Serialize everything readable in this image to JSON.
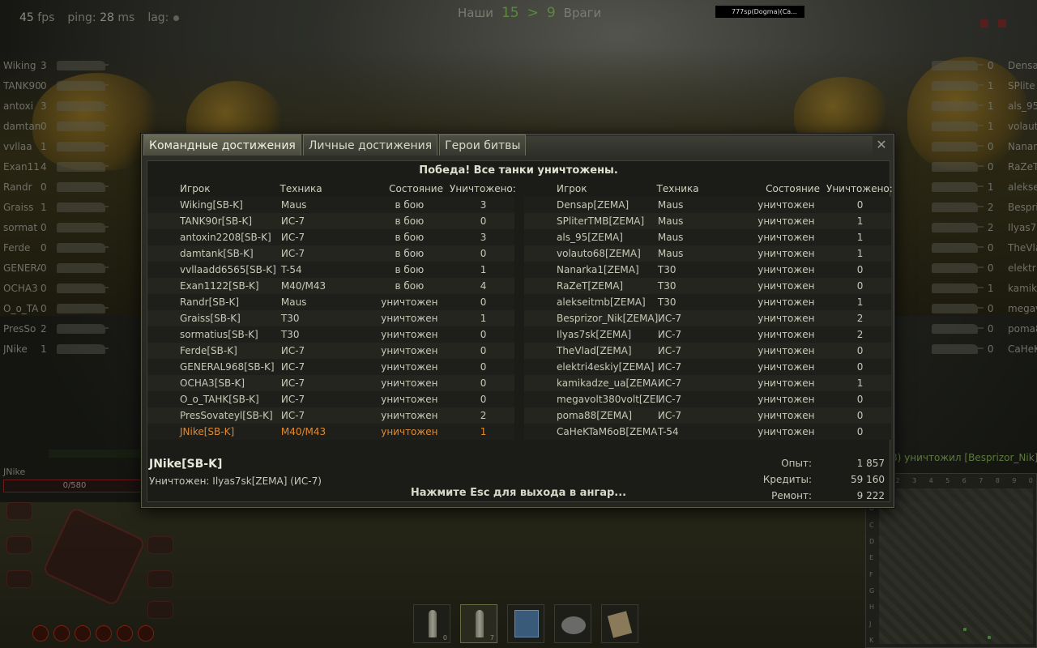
{
  "hud": {
    "fps_value": "45",
    "fps_label": "fps",
    "ping_label": "ping:",
    "ping_value": "28",
    "ping_unit": "ms",
    "lag_label": "lag:",
    "allies_label": "Наши",
    "allies_score": "15",
    "score_sep": ">",
    "enemies_score": "9",
    "enemies_label": "Враги",
    "player_tag": "777sp(Dogma)(Ca..."
  },
  "left_team_side": [
    {
      "name": "Wiking",
      "frags": "3"
    },
    {
      "name": "TANK90",
      "frags": "0"
    },
    {
      "name": "antoxi",
      "frags": "3"
    },
    {
      "name": "damtan",
      "frags": "0"
    },
    {
      "name": "vvllaa",
      "frags": "1"
    },
    {
      "name": "Exan11",
      "frags": "4"
    },
    {
      "name": "Randr",
      "frags": "0"
    },
    {
      "name": "Graiss",
      "frags": "1"
    },
    {
      "name": "sormat",
      "frags": "0"
    },
    {
      "name": "Ferde",
      "frags": "0"
    },
    {
      "name": "GENERA",
      "frags": "0"
    },
    {
      "name": "OCHA3",
      "frags": "0"
    },
    {
      "name": "O_o_TA",
      "frags": "0"
    },
    {
      "name": "PresSo",
      "frags": "2"
    },
    {
      "name": "JNike",
      "frags": "1"
    }
  ],
  "right_team_side": [
    {
      "name": "Densap",
      "frags": "0"
    },
    {
      "name": "SPlite",
      "frags": "1"
    },
    {
      "name": "als_95",
      "frags": "1"
    },
    {
      "name": "volaut",
      "frags": "1"
    },
    {
      "name": "Nanark",
      "frags": "0"
    },
    {
      "name": "RaZeT",
      "frags": "0"
    },
    {
      "name": "alekse",
      "frags": "1"
    },
    {
      "name": "Bespri",
      "frags": "2"
    },
    {
      "name": "Ilyas7",
      "frags": "2"
    },
    {
      "name": "TheVla",
      "frags": "0"
    },
    {
      "name": "elektr",
      "frags": "0"
    },
    {
      "name": "kamika",
      "frags": "1"
    },
    {
      "name": "megavo",
      "frags": "0"
    },
    {
      "name": "poma88",
      "frags": "0"
    },
    {
      "name": "CaHeKT",
      "frags": "0"
    }
  ],
  "self_panel": {
    "name": "JNike",
    "hp": "0/580"
  },
  "kill_message": "8) уничтожил [Besprizor_Nik]",
  "ammo": [
    {
      "type": "shell",
      "count": "0"
    },
    {
      "type": "shell",
      "count": "7"
    },
    {
      "type": "box",
      "count": ""
    },
    {
      "type": "roll",
      "count": ""
    },
    {
      "type": "pack",
      "count": ""
    }
  ],
  "minimap": {
    "cols": [
      "1",
      "2",
      "3",
      "4",
      "5",
      "6",
      "7",
      "8",
      "9",
      "0"
    ],
    "rows": [
      "A",
      "B",
      "C",
      "D",
      "E",
      "F",
      "G",
      "H",
      "J",
      "K"
    ]
  },
  "dialog": {
    "tabs": [
      "Командные достижения",
      "Личные достижения",
      "Герои битвы"
    ],
    "active_tab": 0,
    "close_glyph": "✕",
    "result": "Победа! Все танки уничтожены.",
    "headers": {
      "player": "Игрок",
      "vehicle": "Техника",
      "status": "Состояние",
      "kills": "Уничтожено:"
    },
    "left_team": [
      {
        "player": "Wiking[SB-K]",
        "vehicle": "Maus",
        "status": "в бою",
        "kills": "3"
      },
      {
        "player": "TANK90r[SB-K]",
        "vehicle": "ИС-7",
        "status": "в бою",
        "kills": "0"
      },
      {
        "player": "antoxin2208[SB-K]",
        "vehicle": "ИС-7",
        "status": "в бою",
        "kills": "3"
      },
      {
        "player": "damtank[SB-K]",
        "vehicle": "ИС-7",
        "status": "в бою",
        "kills": "0"
      },
      {
        "player": "vvllaadd6565[SB-K]",
        "vehicle": "T-54",
        "status": "в бою",
        "kills": "1"
      },
      {
        "player": "Exan1122[SB-K]",
        "vehicle": "M40/M43",
        "status": "в бою",
        "kills": "4"
      },
      {
        "player": "Randr[SB-K]",
        "vehicle": "Maus",
        "status": "уничтожен",
        "kills": "0"
      },
      {
        "player": "Graiss[SB-K]",
        "vehicle": "T30",
        "status": "уничтожен",
        "kills": "1"
      },
      {
        "player": "sormatius[SB-K]",
        "vehicle": "T30",
        "status": "уничтожен",
        "kills": "0"
      },
      {
        "player": "Ferde[SB-K]",
        "vehicle": "ИС-7",
        "status": "уничтожен",
        "kills": "0"
      },
      {
        "player": "GENERAL968[SB-K]",
        "vehicle": "ИС-7",
        "status": "уничтожен",
        "kills": "0"
      },
      {
        "player": "OCHA3[SB-K]",
        "vehicle": "ИС-7",
        "status": "уничтожен",
        "kills": "0"
      },
      {
        "player": "O_o_TAHK[SB-K]",
        "vehicle": "ИС-7",
        "status": "уничтожен",
        "kills": "0"
      },
      {
        "player": "PresSovateyl[SB-K]",
        "vehicle": "ИС-7",
        "status": "уничтожен",
        "kills": "2"
      },
      {
        "player": "JNike[SB-K]",
        "vehicle": "M40/M43",
        "status": "уничтожен",
        "kills": "1",
        "self": true
      }
    ],
    "right_team": [
      {
        "player": "Densap[ZEMA]",
        "vehicle": "Maus",
        "status": "уничтожен",
        "kills": "0"
      },
      {
        "player": "SPliterTMB[ZEMA]",
        "vehicle": "Maus",
        "status": "уничтожен",
        "kills": "1"
      },
      {
        "player": "als_95[ZEMA]",
        "vehicle": "Maus",
        "status": "уничтожен",
        "kills": "1"
      },
      {
        "player": "volauto68[ZEMA]",
        "vehicle": "Maus",
        "status": "уничтожен",
        "kills": "1"
      },
      {
        "player": "Nanarka1[ZEMA]",
        "vehicle": "T30",
        "status": "уничтожен",
        "kills": "0"
      },
      {
        "player": "RaZeT[ZEMA]",
        "vehicle": "T30",
        "status": "уничтожен",
        "kills": "0"
      },
      {
        "player": "alekseitmb[ZEMA]",
        "vehicle": "T30",
        "status": "уничтожен",
        "kills": "1"
      },
      {
        "player": "Besprizor_Nik[ZEMA]",
        "vehicle": "ИС-7",
        "status": "уничтожен",
        "kills": "2"
      },
      {
        "player": "Ilyas7sk[ZEMA]",
        "vehicle": "ИС-7",
        "status": "уничтожен",
        "kills": "2"
      },
      {
        "player": "TheVlad[ZEMA]",
        "vehicle": "ИС-7",
        "status": "уничтожен",
        "kills": "0"
      },
      {
        "player": "elektri4eskiy[ZEMA]",
        "vehicle": "ИС-7",
        "status": "уничтожен",
        "kills": "0"
      },
      {
        "player": "kamikadze_ua[ZEMA]",
        "vehicle": "ИС-7",
        "status": "уничтожен",
        "kills": "1"
      },
      {
        "player": "megavolt380volt[ZEMA",
        "vehicle": "ИС-7",
        "status": "уничтожен",
        "kills": "0"
      },
      {
        "player": "poma88[ZEMA]",
        "vehicle": "ИС-7",
        "status": "уничтожен",
        "kills": "0"
      },
      {
        "player": "CaHeKTaM6oB[ZEMA]",
        "vehicle": "T-54",
        "status": "уничтожен",
        "kills": "0"
      }
    ],
    "summary": {
      "player": "JNike[SB-K]",
      "killed_by": "Уничтожен: Ilyas7sk[ZEMA] (ИС-7)",
      "esc_hint": "Нажмите Esc для выхода в ангар...",
      "stats": [
        {
          "label": "Опыт:",
          "value": "1 857"
        },
        {
          "label": "Кредиты:",
          "value": "59 160"
        },
        {
          "label": "Ремонт:",
          "value": "9 222"
        }
      ]
    }
  },
  "colors": {
    "self_highlight": "#e08a30",
    "victory_text": "#e0e0d0",
    "score_green": "#5a8a3a"
  }
}
